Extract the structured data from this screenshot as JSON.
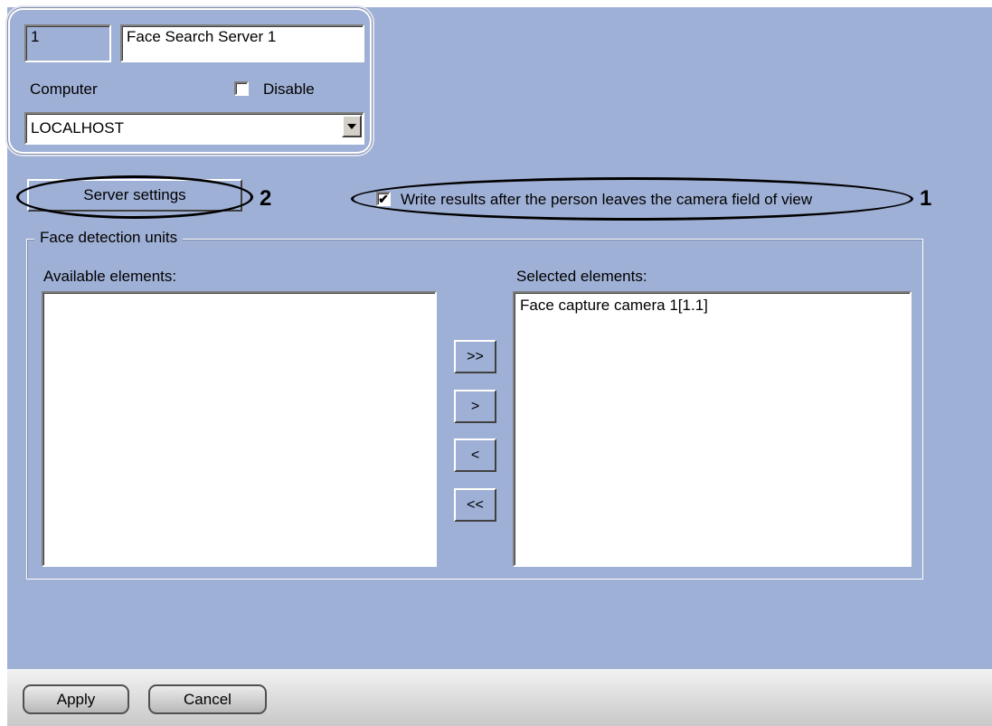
{
  "server": {
    "id_value": "1",
    "name_value": "Face Search Server 1",
    "computer_label": "Computer",
    "disable_label": "Disable",
    "disable_checked": false,
    "computer_value": "LOCALHOST"
  },
  "buttons": {
    "server_settings": "Server settings",
    "add_all": ">>",
    "add": ">",
    "remove": "<",
    "remove_all": "<<",
    "apply": "Apply",
    "cancel": "Cancel"
  },
  "write_results": {
    "label": "Write results after the person leaves the camera field of view",
    "checked": true
  },
  "callouts": {
    "one": "1",
    "two": "2"
  },
  "units": {
    "legend": "Face detection units",
    "available_label": "Available elements:",
    "selected_label": "Selected elements:",
    "available_items": [],
    "selected_items": [
      "Face capture camera 1[1.1]"
    ]
  },
  "colors": {
    "panel": "#9fb0d6",
    "footer": "#d8d8d8"
  }
}
